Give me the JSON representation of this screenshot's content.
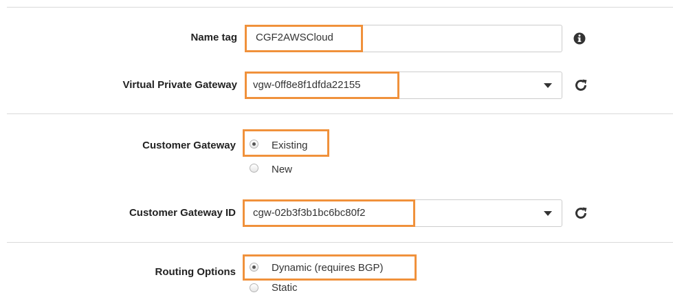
{
  "name_tag": {
    "label": "Name tag",
    "value": "CGF2AWSCloud",
    "info_icon": "info-circle-icon"
  },
  "virtual_private_gateway": {
    "label": "Virtual Private Gateway",
    "selected": "vgw-0ff8e8f1dfda22155",
    "refresh_icon": "refresh-icon"
  },
  "customer_gateway": {
    "label": "Customer Gateway",
    "options": [
      {
        "label": "Existing",
        "checked": true
      },
      {
        "label": "New",
        "checked": false
      }
    ]
  },
  "customer_gateway_id": {
    "label": "Customer Gateway ID",
    "selected": "cgw-02b3f3b1bc6bc80f2",
    "refresh_icon": "refresh-icon"
  },
  "routing_options": {
    "label": "Routing Options",
    "options": [
      {
        "label": "Dynamic (requires BGP)",
        "checked": true
      },
      {
        "label": "Static",
        "checked": false
      }
    ]
  },
  "colors": {
    "highlight": "#f0913b",
    "border": "#cccccc",
    "label": "#222222"
  }
}
